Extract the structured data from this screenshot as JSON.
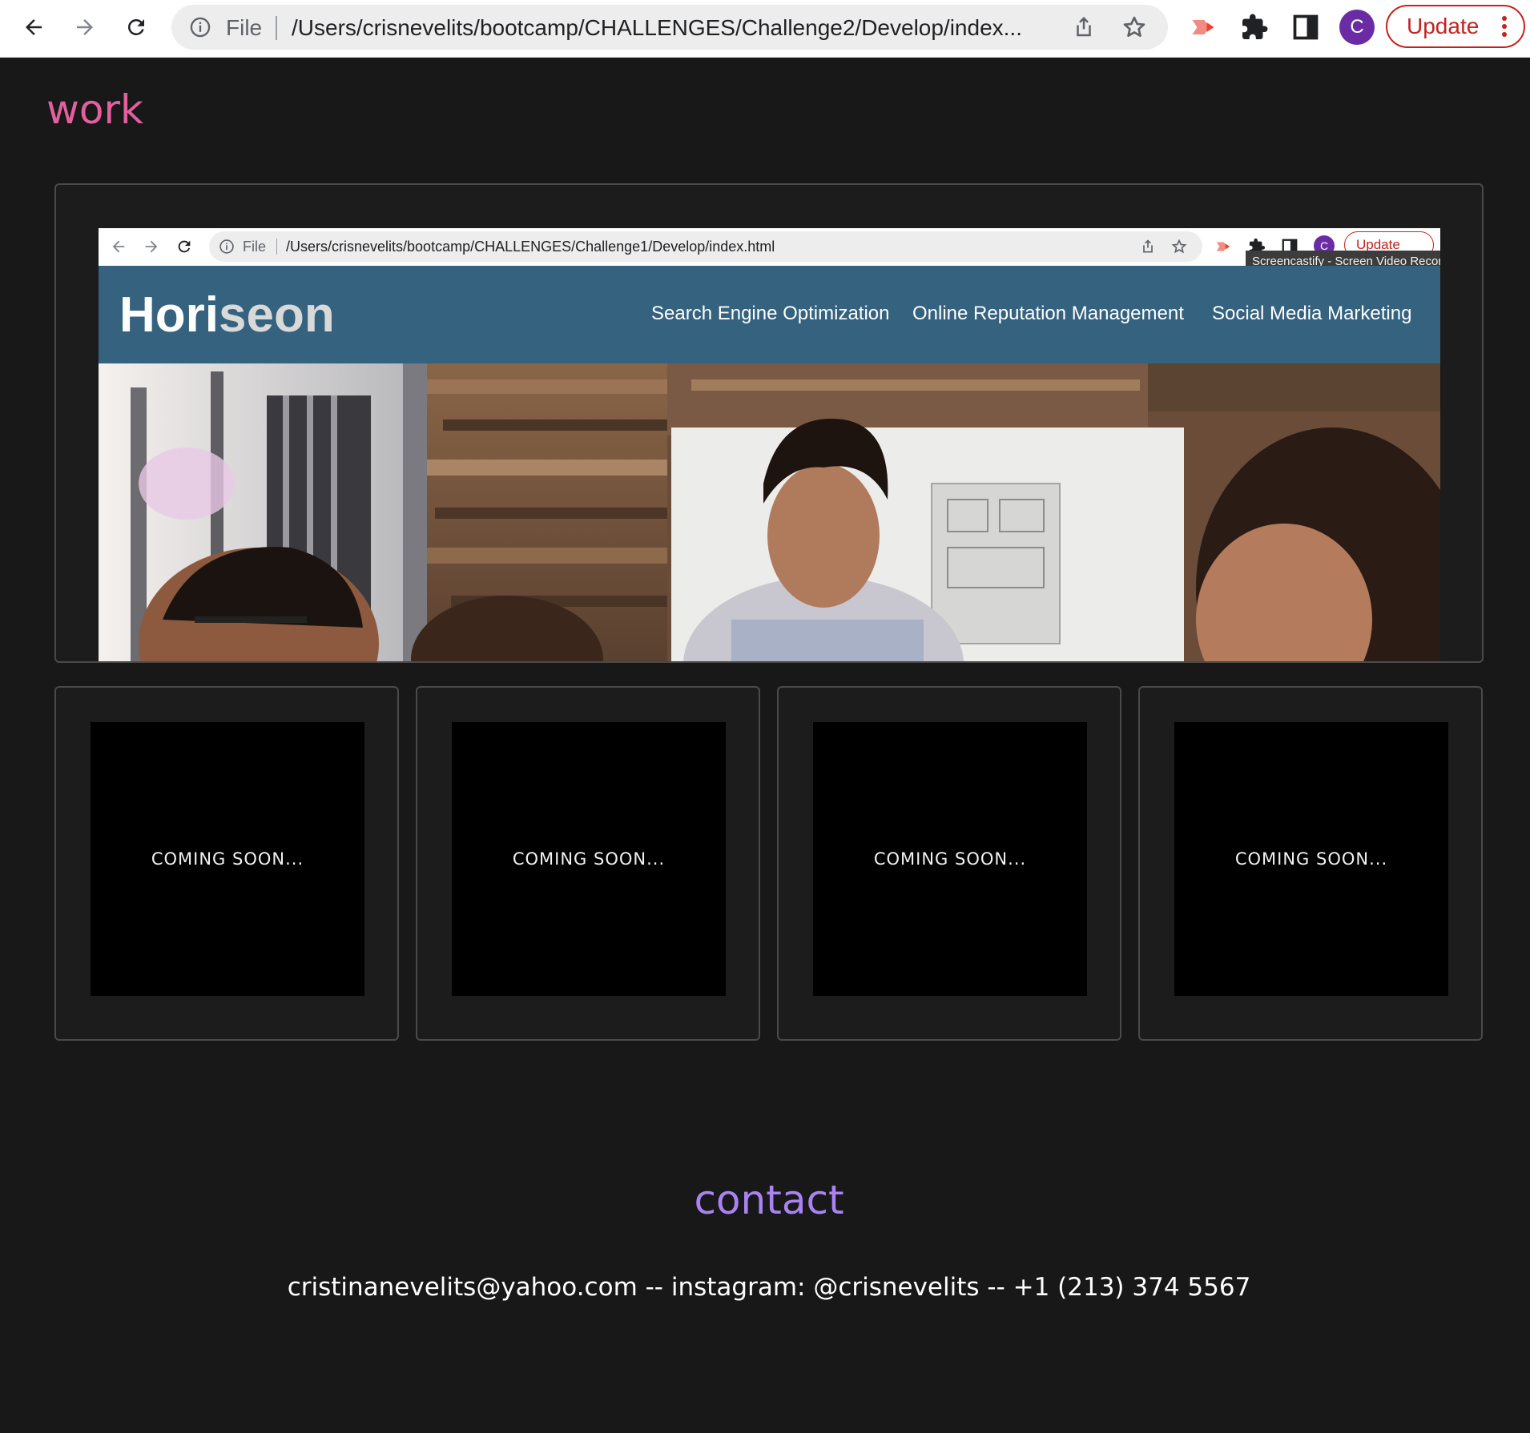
{
  "browser": {
    "scheme_label": "File",
    "url": "/Users/crisnevelits/bootcamp/CHALLENGES/Challenge2/Develop/index...",
    "profile_initial": "C",
    "update_label": "Update",
    "icons": [
      "back-icon",
      "forward-icon",
      "reload-icon",
      "info-icon",
      "share-icon",
      "star-icon",
      "screencastify-icon",
      "extensions-icon",
      "side-panel-icon",
      "more-vert-icon"
    ],
    "colors": {
      "update": "#c5221f",
      "profile": "#6a2ba5"
    }
  },
  "work": {
    "heading": "work",
    "heading_color": "#e2609d",
    "featured": {
      "browser": {
        "scheme_label": "File",
        "url": "/Users/crisnevelits/bootcamp/CHALLENGES/Challenge1/Develop/index.html",
        "profile_initial": "C",
        "update_label": "Update",
        "tooltip": "Screencastify - Screen Video Recor"
      },
      "site": {
        "logo_main": "Hori",
        "logo_accent": "seon",
        "nav": [
          "Search Engine Optimization",
          "Online Reputation Management",
          "Social Media Marketing"
        ],
        "header_color": "#34627f"
      }
    },
    "cards": [
      {
        "label": "COMING SOON..."
      },
      {
        "label": "COMING SOON..."
      },
      {
        "label": "COMING SOON..."
      },
      {
        "label": "COMING SOON..."
      }
    ]
  },
  "contact": {
    "heading": "contact",
    "heading_color": "#a883f1",
    "line": "cristinanevelits@yahoo.com -- instagram: @crisnevelits -- +1 (213) 374 5567"
  }
}
